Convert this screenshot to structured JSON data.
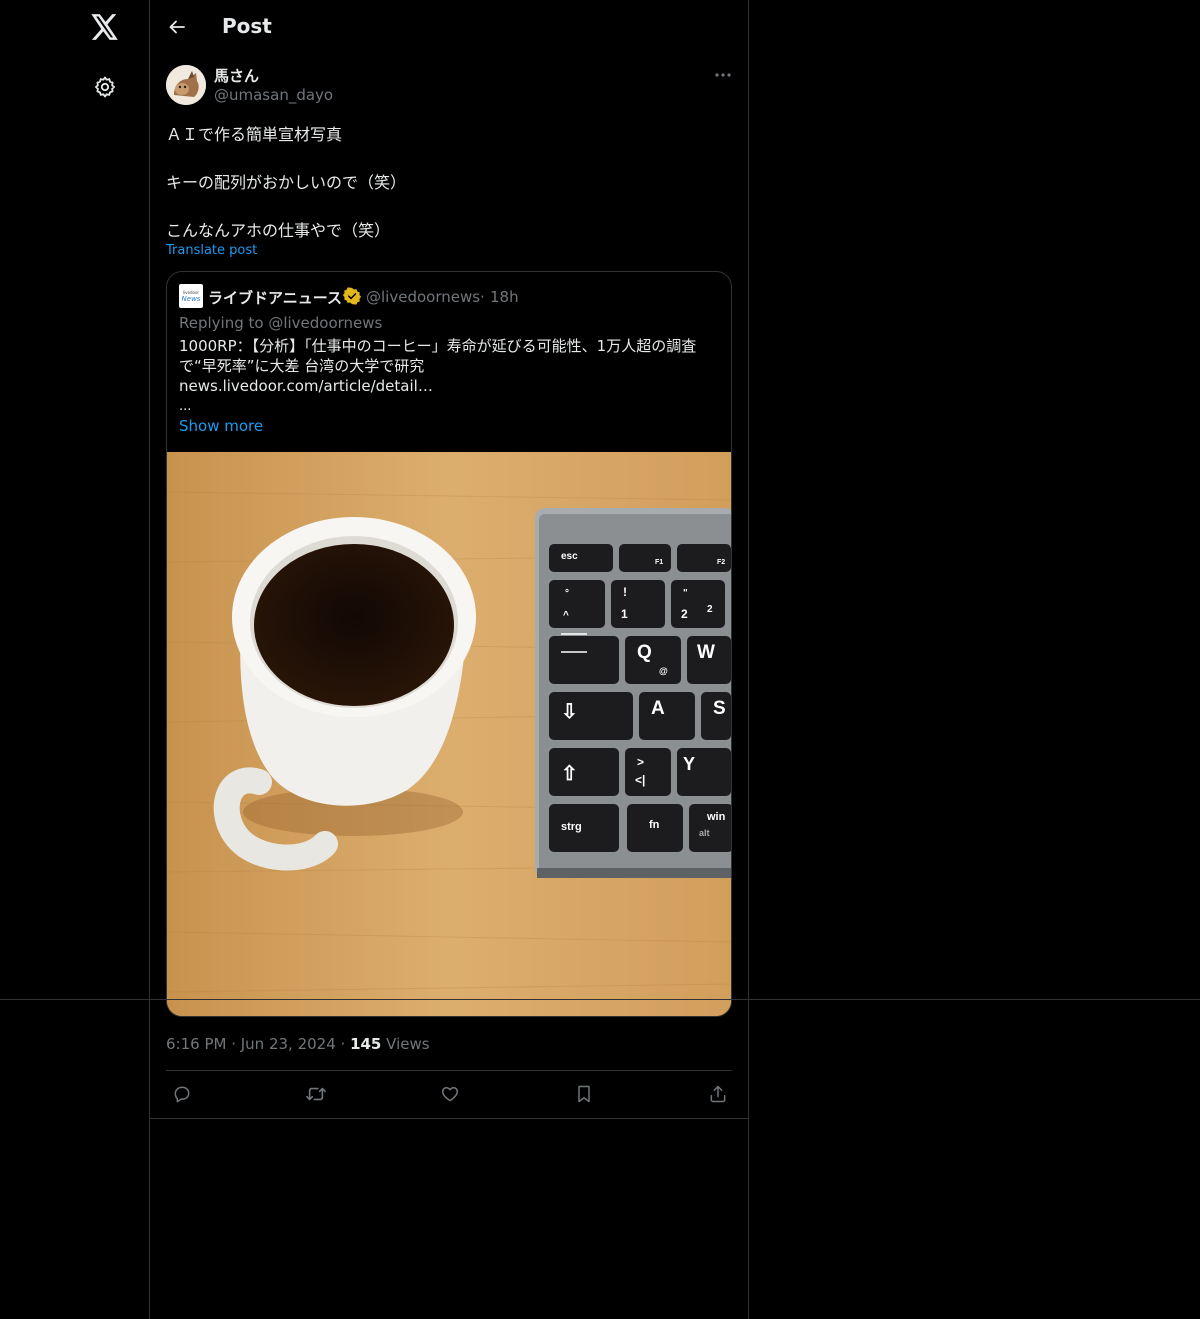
{
  "nav": {
    "logo_icon": "x-logo-icon",
    "settings_icon": "gear-icon"
  },
  "header": {
    "back_icon": "arrow-left-icon",
    "title": "Post"
  },
  "post": {
    "author_name": "馬さん",
    "author_handle": "@umasan_dayo",
    "more_icon": "more-horizontal-icon",
    "lines": [
      "ＡＩで作る簡単宣材写真",
      "キーの配列がおかしいので（笑）",
      "こんなんアホの仕事やで（笑）"
    ],
    "translate_label": "Translate post",
    "timestamp": "6:16 PM · Jun 23, 2024 · ",
    "views_count": "145",
    "views_label": " Views"
  },
  "quote": {
    "logo_line1": "livedoor",
    "logo_line2": "News",
    "author_name": "ライブドアニュース",
    "badge_icon": "verified-badge-icon",
    "author_handle": "@livedoornews",
    "separator": "·",
    "time": "18h",
    "replying": "Replying to @livedoornews",
    "text": "1000RP：【分析】「仕事中のコーヒー」寿命が延びる可能性、1万人超の調査で“早死率”に大差 台湾の大学で研究\nnews.livedoor.com/article/detail…",
    "ellipsis": "...",
    "show_more": "Show more",
    "keys": [
      "esc",
      "F1",
      "F2",
      "°",
      "^",
      "!",
      "1",
      "\"",
      "2",
      "2",
      "Q",
      "@",
      "W",
      "⇩",
      "A",
      "S",
      "⇧",
      ">",
      "<|",
      "Y",
      "strg",
      "fn",
      "win",
      "alt"
    ]
  },
  "actions": {
    "reply_icon": "reply-icon",
    "repost_icon": "repost-icon",
    "like_icon": "heart-icon",
    "bookmark_icon": "bookmark-icon",
    "share_icon": "share-icon"
  },
  "colors": {
    "background": "#000000",
    "text": "#e7e9ea",
    "muted": "#71767b",
    "accent": "#1d9bf0",
    "border": "#2f3336",
    "badge": "#e2b719"
  }
}
